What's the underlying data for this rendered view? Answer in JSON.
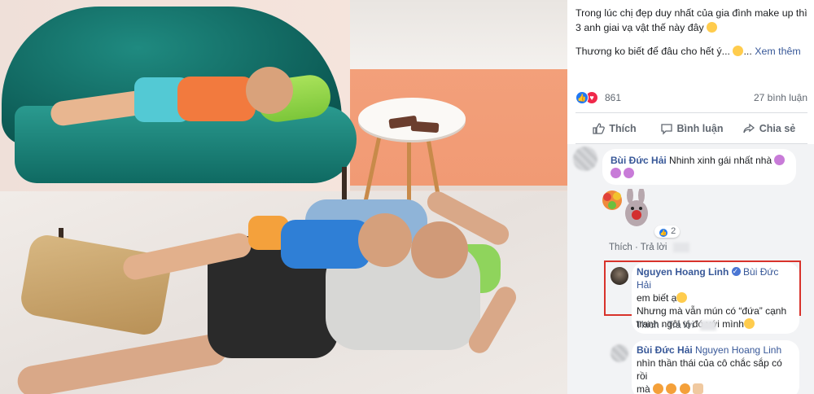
{
  "post": {
    "caption_line1": "Trong lúc chị đẹp duy nhất của gia đình make up thì 3 anh giai vạ vật thế này đây",
    "caption_line2": "Thương ko biết để đâu cho hết ý...",
    "see_more": "Xem thêm",
    "reaction_count": "861",
    "comment_count": "27 bình luận"
  },
  "actions": {
    "like": "Thích",
    "comment": "Bình luận",
    "share": "Chia sẻ"
  },
  "comments": [
    {
      "author": "Bùi Đức Hải",
      "text": "Nhinh xinh gái nhất nhà",
      "sticker_count": "2",
      "like_label": "Thích",
      "reply_label": "Trả lời"
    },
    {
      "author": "Nguyen Hoang Linh",
      "mention": "Bùi Đức Hải",
      "line1": "em biết ạ",
      "line2": "Nhưng mà vẫn mún có “đứa” cạnh",
      "line3": "tranh ngôi vị đó với mình",
      "like_label": "Thích",
      "reply_label": "Trả lời"
    },
    {
      "author": "Bùi Đức Hải",
      "mention": "Nguyen Hoang Linh",
      "line1": "nhìn thần thái của cô chắc sắp có rồi",
      "line2": "mà"
    }
  ],
  "colors": {
    "link": "#385898",
    "highlight": "#d8322b",
    "like_blue": "#2078f4",
    "love_red": "#f0284a"
  }
}
